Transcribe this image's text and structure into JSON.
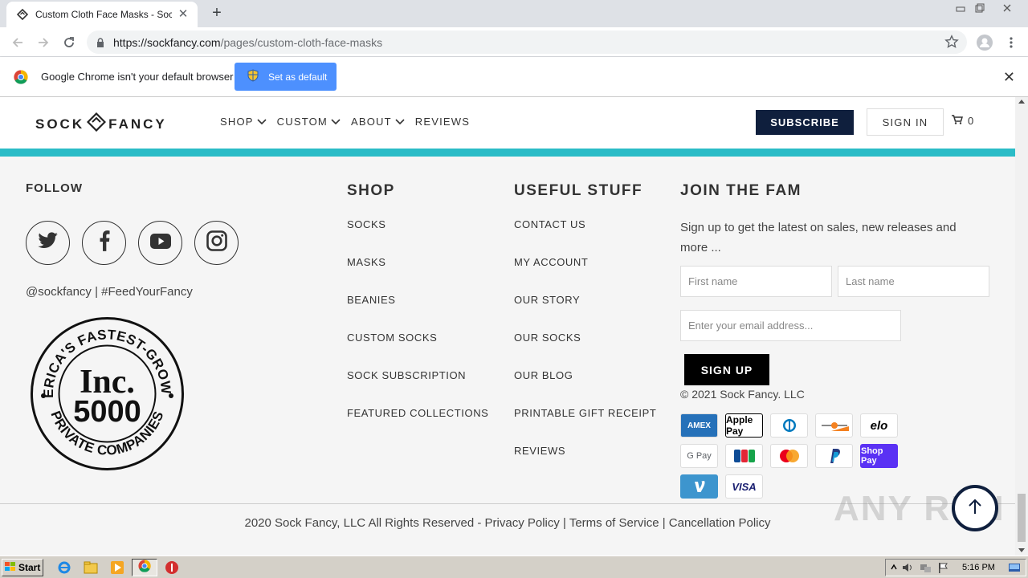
{
  "browser": {
    "tab_title": "Custom Cloth Face Masks - Sock Fancy",
    "url_host": "https://sockfancy.com",
    "url_path": "/pages/custom-cloth-face-masks",
    "infobar_message": "Google Chrome isn't your default browser",
    "infobar_button": "Set as default"
  },
  "header": {
    "logo_left": "SOCK",
    "logo_right": "FANCY",
    "nav": [
      {
        "label": "SHOP",
        "has_dropdown": true
      },
      {
        "label": "CUSTOM",
        "has_dropdown": true
      },
      {
        "label": "ABOUT",
        "has_dropdown": true
      },
      {
        "label": "REVIEWS",
        "has_dropdown": false
      }
    ],
    "subscribe_label": "SUBSCRIBE",
    "signin_label": "SIGN IN",
    "cart_count": "0",
    "accent_color": "#2bbcc7",
    "brand_navy": "#0f1f3d"
  },
  "footer": {
    "follow_heading": "FOLLOW",
    "social_icons": [
      "twitter-icon",
      "facebook-icon",
      "youtube-icon",
      "instagram-icon"
    ],
    "handle": "@sockfancy | #FeedYourFancy",
    "inc_badge": {
      "top_text": "AMERICA'S FASTEST-GROWING",
      "line1": "Inc.",
      "line2": "5000",
      "bottom_text": "PRIVATE COMPANIES"
    },
    "shop": {
      "heading": "SHOP",
      "links": [
        "SOCKS",
        "MASKS",
        "BEANIES",
        "CUSTOM SOCKS",
        "SOCK SUBSCRIPTION",
        "FEATURED COLLECTIONS"
      ]
    },
    "useful": {
      "heading": "USEFUL STUFF",
      "links": [
        "CONTACT US",
        "MY ACCOUNT",
        "OUR STORY",
        "OUR SOCKS",
        "OUR BLOG",
        "PRINTABLE GIFT RECEIPT",
        "REVIEWS"
      ]
    },
    "join": {
      "heading": "JOIN THE FAM",
      "description": "Sign up to get the latest on sales, new releases and more ...",
      "first_name_placeholder": "First name",
      "last_name_placeholder": "Last name",
      "email_placeholder": "Enter your email address...",
      "signup_label": "SIGN UP",
      "copyright": "© 2021 Sock Fancy. LLC"
    },
    "payment_methods": [
      "AMEX",
      "Apple Pay",
      "Diners Club",
      "Discover",
      "elo",
      "G Pay",
      "JCB",
      "Mastercard",
      "PayPal",
      "Shop Pay",
      "Venmo",
      "VISA"
    ],
    "legal": {
      "prefix": "2020 Sock Fancy, LLC All Rights Reserved - ",
      "privacy": "Privacy Policy",
      "sep1": " | ",
      "terms": "Terms of Service",
      "sep2": " | ",
      "cancellation": "Cancellation Policy"
    },
    "watermark": "ANY RUN"
  },
  "taskbar": {
    "start_label": "Start",
    "clock": "5:16 PM"
  }
}
